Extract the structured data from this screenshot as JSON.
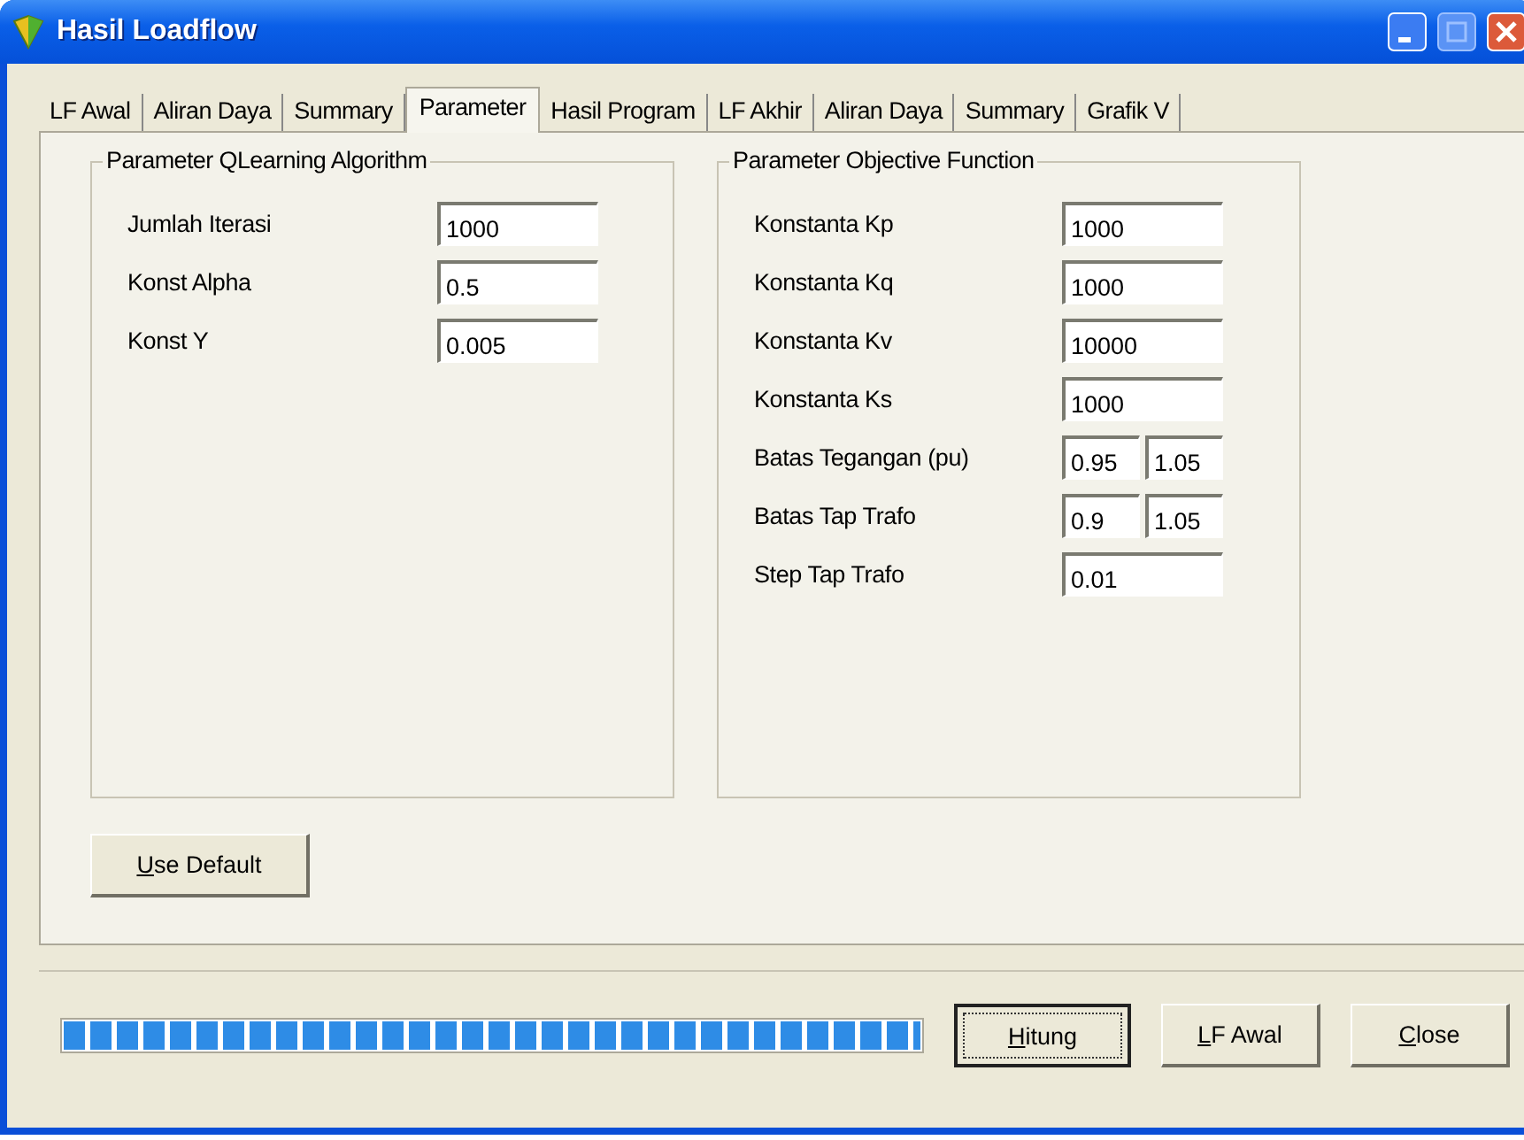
{
  "window": {
    "title": "Hasil Loadflow"
  },
  "tabs": [
    {
      "label": "LF Awal",
      "selected": false
    },
    {
      "label": "Aliran Daya",
      "selected": false
    },
    {
      "label": "Summary",
      "selected": false
    },
    {
      "label": "Parameter",
      "selected": true
    },
    {
      "label": "Hasil Program",
      "selected": false
    },
    {
      "label": "LF Akhir",
      "selected": false
    },
    {
      "label": "Aliran Daya",
      "selected": false
    },
    {
      "label": "Summary",
      "selected": false
    },
    {
      "label": "Grafik V",
      "selected": false
    }
  ],
  "groups": [
    {
      "title": "Parameter QLearning Algorithm",
      "fields": [
        {
          "label": "Jumlah Iterasi",
          "values": [
            "1000"
          ]
        },
        {
          "label": "Konst Alpha",
          "values": [
            "0.5"
          ]
        },
        {
          "label": "Konst Y",
          "values": [
            "0.005"
          ]
        }
      ]
    },
    {
      "title": "Parameter Objective Function",
      "fields": [
        {
          "label": "Konstanta Kp",
          "values": [
            "1000"
          ]
        },
        {
          "label": "Konstanta Kq",
          "values": [
            "1000"
          ]
        },
        {
          "label": "Konstanta Kv",
          "values": [
            "10000"
          ]
        },
        {
          "label": "Konstanta Ks",
          "values": [
            "1000"
          ]
        },
        {
          "label": "Batas Tegangan (pu)",
          "values": [
            "0.95",
            "1.05"
          ]
        },
        {
          "label": "Batas Tap Trafo",
          "values": [
            "0.9",
            "1.05"
          ]
        },
        {
          "label": "Step Tap Trafo",
          "values": [
            "0.01"
          ]
        }
      ]
    }
  ],
  "default_button": "Use Default",
  "progress": {
    "level": 1
  },
  "buttons": [
    {
      "label": "Hitung",
      "focused": true
    },
    {
      "label": "LF Awal",
      "focused": false
    },
    {
      "label": "Close",
      "focused": false
    }
  ]
}
